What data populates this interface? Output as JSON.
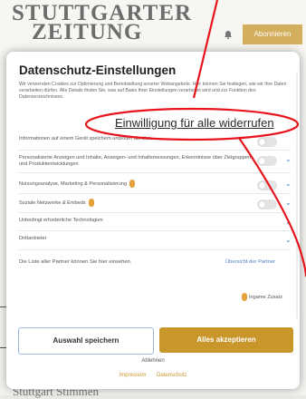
{
  "background": {
    "logo_line1": "STUTTGARTER",
    "logo_line2": "ZEITUNG",
    "subscribe_label": "Abonnieren",
    "footer_text": "Stuttgart Stimmen"
  },
  "dialog": {
    "title": "Datenschutz-Einstellungen",
    "intro": "Wir verwenden Cookies zur Optimierung und Bereitstellung unserer Webangebote. Hier können Sie festlegen, wie wir Ihre Daten verarbeiten dürfen. Alle Details finden Sie, was auf Basis Ihrer Einstellungen verarbeitet wird und zur Funktion des Datenverzeichnisses.",
    "revoke_link": "Einwilligung für alle widerrufen",
    "rows": [
      {
        "label": "Informationen auf einem Gerät speichern und/oder abrufen"
      },
      {
        "label": "Personalisierte Anzeigen und Inhalte, Anzeigen- und Inhaltsmessungen, Erkenntnisse über Zielgruppen und Produktentwicklungen"
      },
      {
        "label": "Nutzungsanalyse, Marketing & Personalisierung"
      },
      {
        "label": "Soziale Netzwerke & Embeds"
      },
      {
        "label": "Unbedingt erforderliche Technologien"
      },
      {
        "label": "Drittanbieter"
      }
    ],
    "note": "Die Liste aller Partner können Sie hier einsehen.",
    "details_link": "Übersicht der Partner",
    "legend": "Ingame Zusatz",
    "save_button": "Auswahl speichern",
    "accept_button": "Alles akzeptieren",
    "reject_link": "Ablehnen",
    "legal_links": [
      "Impressum",
      "Datenschutz"
    ]
  },
  "colors": {
    "accent": "#c8962b",
    "link": "#4b7fc7",
    "annotation": "#e8141c"
  }
}
